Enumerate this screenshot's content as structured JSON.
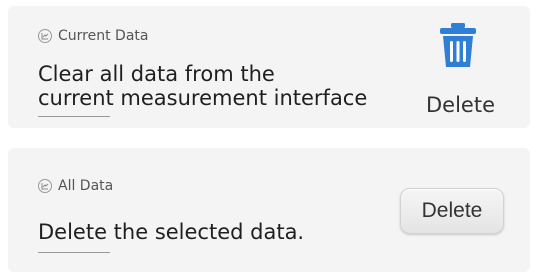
{
  "current_data": {
    "tag_icon": "chart-icon",
    "tag_label": "Current Data",
    "description": "Clear all data from the\ncurrent measurement interface",
    "action_icon": "trash-icon",
    "action_icon_color": "#2f7fd6",
    "action_label": "Delete"
  },
  "all_data": {
    "tag_icon": "chart-icon",
    "tag_label": "All Data",
    "description": "Delete the selected data.",
    "action_label": "Delete"
  }
}
